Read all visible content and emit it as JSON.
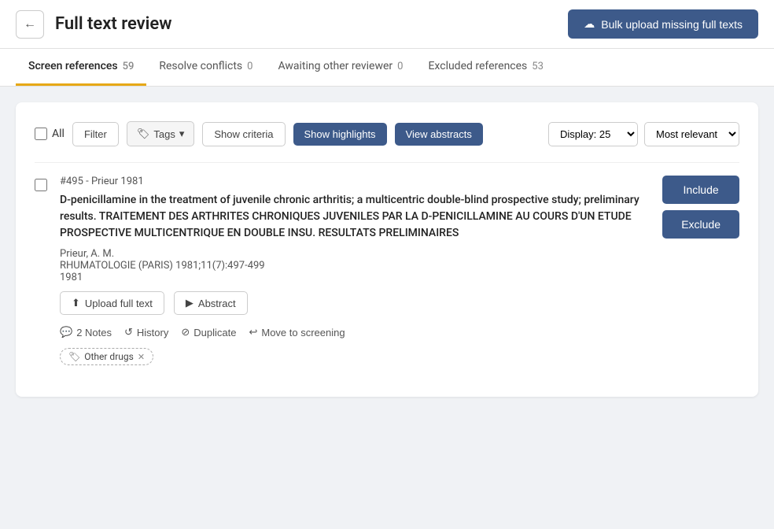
{
  "header": {
    "back_label": "←",
    "title": "Full text review",
    "bulk_upload_label": "Bulk upload missing full texts",
    "bulk_upload_icon": "☁"
  },
  "tabs": [
    {
      "id": "screen",
      "label": "Screen references",
      "count": "59",
      "active": true
    },
    {
      "id": "resolve",
      "label": "Resolve conflicts",
      "count": "0",
      "active": false
    },
    {
      "id": "awaiting",
      "label": "Awaiting other reviewer",
      "count": "0",
      "active": false
    },
    {
      "id": "excluded",
      "label": "Excluded references",
      "count": "53",
      "active": false
    }
  ],
  "toolbar": {
    "all_label": "All",
    "filter_label": "Filter",
    "tags_label": "Tags",
    "show_criteria_label": "Show criteria",
    "show_highlights_label": "Show highlights",
    "view_abstracts_label": "View abstracts",
    "display_label": "Display: 25",
    "sort_label": "Most relevant"
  },
  "references": [
    {
      "id": "#495 - Prieur 1981",
      "title": "D-penicillamine in the treatment of juvenile chronic arthritis; a multicentric double-blind prospective study; preliminary results. TRAITEMENT DES ARTHRITES CHRONIQUES JUVENILES PAR LA D-PENICILLAMINE AU COURS D'UN ETUDE PROSPECTIVE MULTICENTRIQUE EN DOUBLE INSU. RESULTATS PRELIMINAIRES",
      "author": "Prieur, A. M.",
      "journal": "RHUMATOLOGIE (PARIS) 1981;11(7):497-499",
      "year": "1981",
      "include_label": "Include",
      "exclude_label": "Exclude",
      "upload_label": "Upload full text",
      "abstract_label": "Abstract",
      "notes_label": "2 Notes",
      "history_label": "History",
      "duplicate_label": "Duplicate",
      "move_label": "Move to screening",
      "tag_label": "Other drugs",
      "tag_icon": "🏷"
    }
  ]
}
